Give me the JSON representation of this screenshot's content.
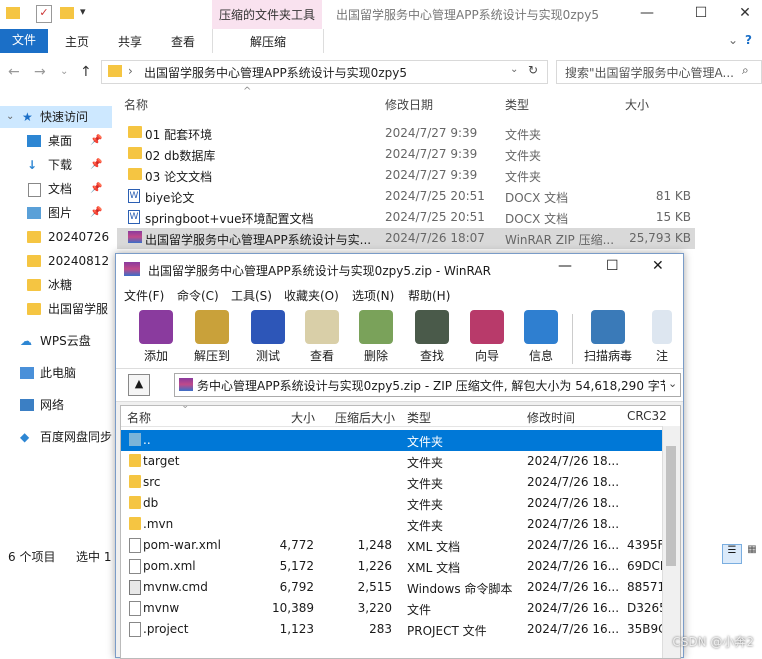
{
  "explorer": {
    "context_tab": "压缩的文件夹工具",
    "window_title": "出国留学服务中心管理APP系统设计与实现0zpy5",
    "ribbon": {
      "file": "文件",
      "home": "主页",
      "share": "共享",
      "view": "查看",
      "extract": "解压缩"
    },
    "address": "出国留学服务中心管理APP系统设计与实现0zpy5",
    "search_placeholder": "搜索\"出国留学服务中心管理A...",
    "nav": [
      {
        "label": "快速访问",
        "icon": "star-icon"
      },
      {
        "label": "桌面",
        "icon": "desktop-icon"
      },
      {
        "label": "下载",
        "icon": "download-icon"
      },
      {
        "label": "文档",
        "icon": "document-icon"
      },
      {
        "label": "图片",
        "icon": "picture-icon"
      },
      {
        "label": "20240726",
        "icon": "folder-icon"
      },
      {
        "label": "20240812",
        "icon": "folder-icon"
      },
      {
        "label": "冰糖",
        "icon": "folder-icon"
      },
      {
        "label": "出国留学服",
        "icon": "folder-icon"
      },
      {
        "label": "WPS云盘",
        "icon": "cloud-icon"
      },
      {
        "label": "此电脑",
        "icon": "computer-icon"
      },
      {
        "label": "网络",
        "icon": "network-icon"
      },
      {
        "label": "百度网盘同步",
        "icon": "baidu-icon"
      }
    ],
    "columns": {
      "name": "名称",
      "date": "修改日期",
      "type": "类型",
      "size": "大小"
    },
    "files": [
      {
        "name": "01 配套环境",
        "date": "2024/7/27 9:39",
        "type": "文件夹",
        "size": ""
      },
      {
        "name": "02 db数据库",
        "date": "2024/7/27 9:39",
        "type": "文件夹",
        "size": ""
      },
      {
        "name": "03 论文文档",
        "date": "2024/7/27 9:39",
        "type": "文件夹",
        "size": ""
      },
      {
        "name": "biye论文",
        "date": "2024/7/25 20:51",
        "type": "DOCX 文档",
        "size": "81 KB"
      },
      {
        "name": "springboot+vue环境配置文档",
        "date": "2024/7/25 20:51",
        "type": "DOCX 文档",
        "size": "15 KB"
      },
      {
        "name": "出国留学服务中心管理APP系统设计与实...",
        "date": "2024/7/26 18:07",
        "type": "WinRAR ZIP 压缩...",
        "size": "25,793 KB"
      }
    ],
    "status_count": "6 个项目",
    "status_selected": "选中 1"
  },
  "winrar": {
    "title": "出国留学服务中心管理APP系统设计与实现0zpy5.zip - WinRAR",
    "menu": [
      "文件(F)",
      "命令(C)",
      "工具(S)",
      "收藏夹(O)",
      "选项(N)",
      "帮助(H)"
    ],
    "tools": [
      {
        "label": "添加",
        "color": "#8a3b9e"
      },
      {
        "label": "解压到",
        "color": "#c9a13a"
      },
      {
        "label": "测试",
        "color": "#2d56b8"
      },
      {
        "label": "查看",
        "color": "#d9cfa8"
      },
      {
        "label": "删除",
        "color": "#7aa25a"
      },
      {
        "label": "查找",
        "color": "#4a5a4a"
      },
      {
        "label": "向导",
        "color": "#b83a6a"
      },
      {
        "label": "信息",
        "color": "#2f7fd0"
      },
      {
        "label": "扫描病毒",
        "color": "#3a7ab8"
      },
      {
        "label": "注",
        "color": "#dde6f0"
      }
    ],
    "path": "务中心管理APP系统设计与实现0zpy5.zip - ZIP 压缩文件, 解包大小为 54,618,290 字节",
    "columns": {
      "name": "名称",
      "size": "大小",
      "packed": "压缩后大小",
      "type": "类型",
      "modified": "修改时间",
      "crc": "CRC32"
    },
    "rows": [
      {
        "name": "..",
        "size": "",
        "packed": "",
        "type": "文件夹",
        "modified": "",
        "crc": "",
        "icon": "folder"
      },
      {
        "name": "target",
        "size": "",
        "packed": "",
        "type": "文件夹",
        "modified": "2024/7/26 18...",
        "crc": "",
        "icon": "folder"
      },
      {
        "name": "src",
        "size": "",
        "packed": "",
        "type": "文件夹",
        "modified": "2024/7/26 18...",
        "crc": "",
        "icon": "folder"
      },
      {
        "name": "db",
        "size": "",
        "packed": "",
        "type": "文件夹",
        "modified": "2024/7/26 18...",
        "crc": "",
        "icon": "folder"
      },
      {
        "name": ".mvn",
        "size": "",
        "packed": "",
        "type": "文件夹",
        "modified": "2024/7/26 18...",
        "crc": "",
        "icon": "folder"
      },
      {
        "name": "pom-war.xml",
        "size": "4,772",
        "packed": "1,248",
        "type": "XML 文档",
        "modified": "2024/7/26 16...",
        "crc": "4395F",
        "icon": "file"
      },
      {
        "name": "pom.xml",
        "size": "5,172",
        "packed": "1,226",
        "type": "XML 文档",
        "modified": "2024/7/26 16...",
        "crc": "69DCE",
        "icon": "file"
      },
      {
        "name": "mvnw.cmd",
        "size": "6,792",
        "packed": "2,515",
        "type": "Windows 命令脚本",
        "modified": "2024/7/26 16...",
        "crc": "88571",
        "icon": "file"
      },
      {
        "name": "mvnw",
        "size": "10,389",
        "packed": "3,220",
        "type": "文件",
        "modified": "2024/7/26 16...",
        "crc": "D3265",
        "icon": "file"
      },
      {
        "name": ".project",
        "size": "1,123",
        "packed": "283",
        "type": "PROJECT 文件",
        "modified": "2024/7/26 16...",
        "crc": "35B9C",
        "icon": "file"
      }
    ]
  },
  "watermark": "CSDN @小奔2"
}
